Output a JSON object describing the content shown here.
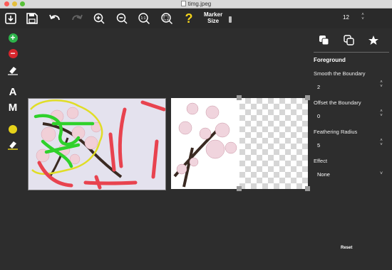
{
  "window": {
    "title": "timg.jpeg"
  },
  "toolbar": {
    "icons": [
      "import-icon",
      "save-icon",
      "undo-icon",
      "redo-icon",
      "zoom-in-icon",
      "zoom-out-icon",
      "zoom-actual-icon",
      "zoom-fit-icon",
      "help-icon"
    ],
    "zoom_actual_label": "1:1",
    "help_label": "?",
    "marker_label_line1": "Marker",
    "marker_label_line2": "Size",
    "marker_value": "12",
    "stepper_up": "˄",
    "stepper_down": "˅"
  },
  "left_tools": {
    "add_label": "+",
    "remove_label": "−",
    "auto_label": "A",
    "manual_label": "M",
    "marker_color": "#e6d21a"
  },
  "panel": {
    "tabs": [
      "foreground-tab-icon",
      "background-tab-icon",
      "favorite-tab-icon"
    ],
    "title": "Foreground",
    "smooth_label": "Smooth the Boundary",
    "smooth_value": "2",
    "offset_label": "Offset the Boundary",
    "offset_value": "0",
    "feather_label": "Feathering Radius",
    "feather_value": "5",
    "effect_label": "Effect",
    "effect_value": "None",
    "reset_label": "Reset"
  },
  "colors": {
    "add": "#2db34a",
    "remove": "#d8262d",
    "help": "#f2d21b",
    "foreground_stroke": "#2fd12b",
    "background_stroke": "#e8434f"
  }
}
